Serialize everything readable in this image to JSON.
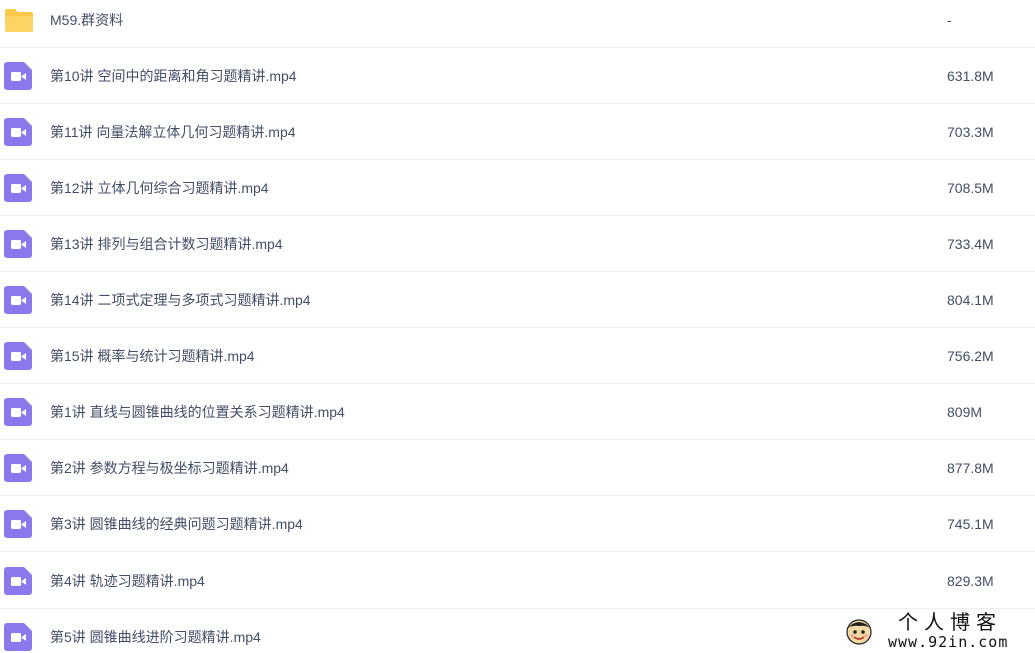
{
  "colors": {
    "folder": "#f9c94a",
    "video_icon": "#8a78ec",
    "text": "#424e67",
    "divider": "#eceff3"
  },
  "files": [
    {
      "name": "M59.群资料",
      "size": "-",
      "icon": "folder-icon"
    },
    {
      "name": "第10讲 空间中的距离和角习题精讲.mp4",
      "size": "631.8M",
      "icon": "video-file-icon"
    },
    {
      "name": "第11讲 向量法解立体几何习题精讲.mp4",
      "size": "703.3M",
      "icon": "video-file-icon"
    },
    {
      "name": "第12讲 立体几何综合习题精讲.mp4",
      "size": "708.5M",
      "icon": "video-file-icon"
    },
    {
      "name": "第13讲 排列与组合计数习题精讲.mp4",
      "size": "733.4M",
      "icon": "video-file-icon"
    },
    {
      "name": "第14讲 二项式定理与多项式习题精讲.mp4",
      "size": "804.1M",
      "icon": "video-file-icon"
    },
    {
      "name": "第15讲 概率与统计习题精讲.mp4",
      "size": "756.2M",
      "icon": "video-file-icon"
    },
    {
      "name": "第1讲 直线与圆锥曲线的位置关系习题精讲.mp4",
      "size": "809M",
      "icon": "video-file-icon"
    },
    {
      "name": "第2讲 参数方程与极坐标习题精讲.mp4",
      "size": "877.8M",
      "icon": "video-file-icon"
    },
    {
      "name": "第3讲 圆锥曲线的经典问题习题精讲.mp4",
      "size": "745.1M",
      "icon": "video-file-icon"
    },
    {
      "name": "第4讲 轨迹习题精讲.mp4",
      "size": "829.3M",
      "icon": "video-file-icon"
    },
    {
      "name": "第5讲 圆锥曲线进阶习题精讲.mp4",
      "size": "",
      "icon": "video-file-icon"
    }
  ],
  "watermark": {
    "title": "个人博客",
    "url": "www.92in.com"
  }
}
